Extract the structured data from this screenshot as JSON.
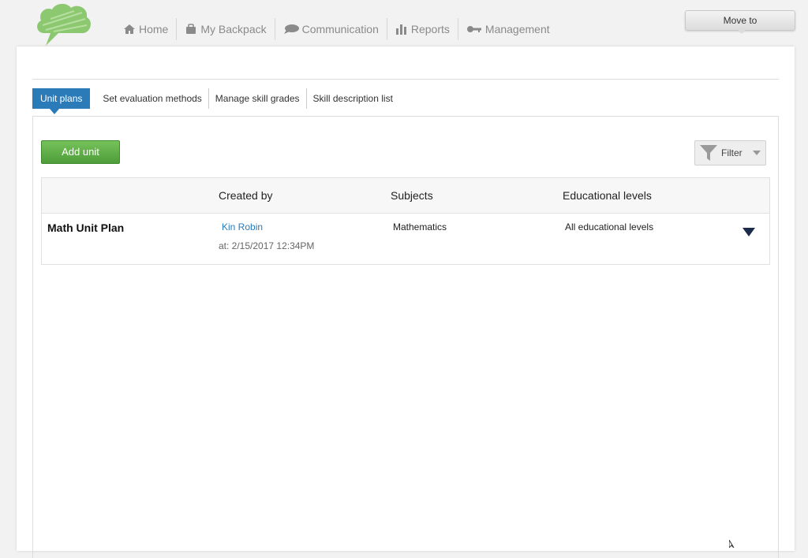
{
  "header": {
    "logo_icon": "speech-cloud-logo",
    "nav": [
      {
        "label": "Home",
        "icon": "house-icon"
      },
      {
        "label": "My Backpack",
        "icon": "backpack-icon"
      },
      {
        "label": "Communication",
        "icon": "speech-bubble-icon"
      },
      {
        "label": "Reports",
        "icon": "bar-chart-icon"
      },
      {
        "label": "Management",
        "icon": "key-icon"
      }
    ],
    "move_to_label": "Move to"
  },
  "tabs": [
    {
      "label": "Unit plans",
      "active": true
    },
    {
      "label": "Set evaluation methods",
      "active": false
    },
    {
      "label": "Manage skill grades",
      "active": false
    },
    {
      "label": "Skill description list",
      "active": false
    }
  ],
  "toolbar": {
    "add_unit_label": "Add unit",
    "filter_label": "Filter"
  },
  "table": {
    "columns": [
      "",
      "Created by",
      "Subjects",
      "Educational levels"
    ],
    "rows": [
      {
        "title": "Math Unit Plan",
        "created_by": "Kin Robin",
        "created_at": "at: 2/15/2017 12:34PM",
        "subjects": "Mathematics",
        "levels": "All educational levels"
      }
    ]
  },
  "colors": {
    "accent": "#2b7bb9",
    "add_button": "#5fae45",
    "logo_green": "#8cc870"
  }
}
